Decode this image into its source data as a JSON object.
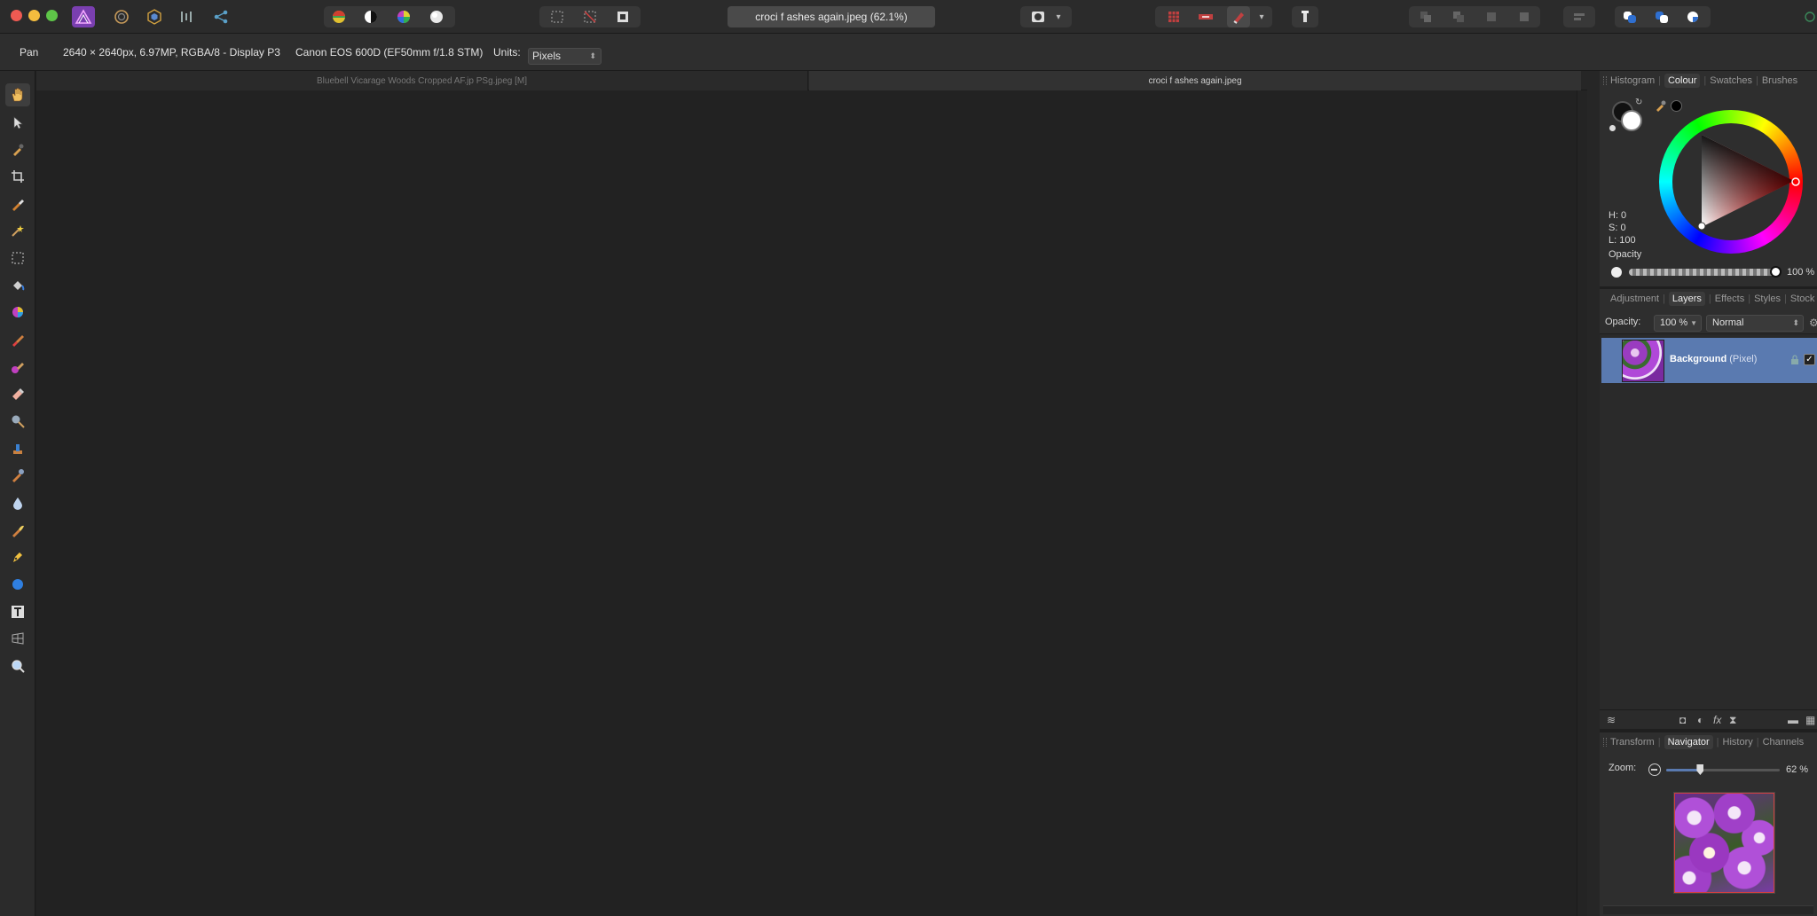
{
  "window": {
    "document_title": "croci f ashes again.jpeg (62.1%)"
  },
  "context_toolbar": {
    "tool_name": "Pan",
    "image_info": "2640 × 2640px, 6.97MP, RGBA/8 - Display P3",
    "camera_info": "Canon EOS 600D (EF50mm f/1.8 STM)",
    "units_label": "Units:",
    "units_value": "Pixels"
  },
  "document_tabs": [
    {
      "label": "Bluebell Vicarage Woods Cropped AF.jp PSg.jpeg [M]",
      "active": false
    },
    {
      "label": "croci f ashes again.jpeg",
      "active": true
    }
  ],
  "colour_panel": {
    "tabs": [
      "Histogram",
      "Colour",
      "Swatches",
      "Brushes"
    ],
    "active_tab": "Colour",
    "h_label": "H: 0",
    "s_label": "S: 0",
    "l_label": "L: 100",
    "opacity_label": "Opacity",
    "opacity_value": "100 %"
  },
  "layers_panel": {
    "tabs": [
      "Adjustment",
      "Layers",
      "Effects",
      "Styles",
      "Stock"
    ],
    "active_tab": "Layers",
    "opacity_label": "Opacity:",
    "opacity_value": "100 %",
    "blend_mode": "Normal",
    "layers": [
      {
        "name": "Background",
        "type": "(Pixel)",
        "visible": true
      }
    ]
  },
  "navigator_panel": {
    "tabs": [
      "Transform",
      "Navigator",
      "History",
      "Channels"
    ],
    "active_tab": "Navigator",
    "zoom_label": "Zoom:",
    "zoom_value": "62 %",
    "zoom_fraction": 0.3
  },
  "colors": {
    "accent_selected_layer": "#5a7ab0",
    "app_bg": "#1f1f1f",
    "foreground_colour": "#111111",
    "background_colour": "#ffffff"
  }
}
